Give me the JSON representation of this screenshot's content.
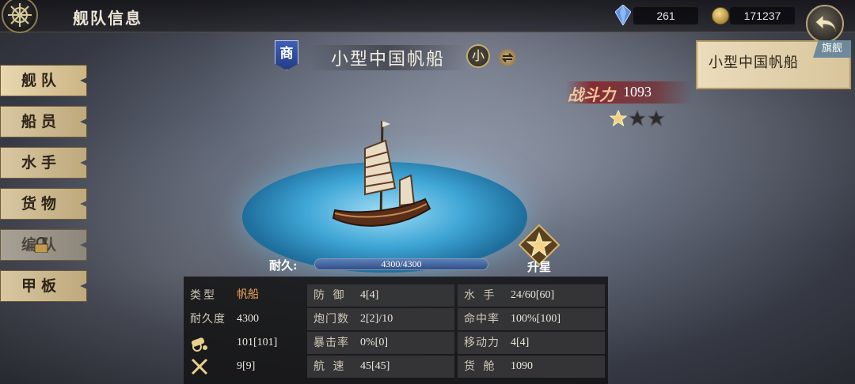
{
  "header": {
    "title": "舰队信息"
  },
  "resources": {
    "gems": "261",
    "coins": "171237"
  },
  "tabs": [
    {
      "label": "舰队"
    },
    {
      "label": "船员"
    },
    {
      "label": "水手"
    },
    {
      "label": "货物"
    },
    {
      "label": "编队"
    },
    {
      "label": "甲板"
    }
  ],
  "ship": {
    "shop_badge": "商",
    "name": "小型中国帆船",
    "size_badge": "小",
    "power_label": "战斗力",
    "power_value": "1093",
    "stars_total": 3,
    "stars_filled": 1,
    "durability_label": "耐久:",
    "durability_text": "4300/4300",
    "durability_fraction": 1.0,
    "upgrade_label": "升星"
  },
  "stats": {
    "type_label": "类型",
    "type_value": "帆船",
    "dur_label": "耐久度",
    "dur_value": "4300",
    "cannon_value": "101[101]",
    "attack_value": "9[9]",
    "defense_label": "防 御",
    "defense_value": "4[4]",
    "gun_ports_label": "炮门数",
    "gun_ports_value": "2[2]/10",
    "crit_label": "暴击率",
    "crit_value": "0%[0]",
    "speed_label": "航 速",
    "speed_value": "45[45]",
    "sailors_label": "水 手",
    "sailors_value": "24/60[60]",
    "hit_label": "命中率",
    "hit_value": "100%[100]",
    "move_label": "移动力",
    "move_value": "4[4]",
    "cargo_label": "货 舱",
    "cargo_value": "1090"
  },
  "fleet_card": {
    "ship_name": "小型中国帆船",
    "flag_tag": "旗舰"
  },
  "icons": {
    "menu": "ship-wheel-icon",
    "gem": "gem-icon",
    "coin": "coin-icon",
    "back": "back-arrow-icon",
    "cannon": "cannon-icon",
    "attack": "crossed-swords-icon",
    "upgrade": "star-upgrade-icon",
    "lock": "lock-icon"
  }
}
